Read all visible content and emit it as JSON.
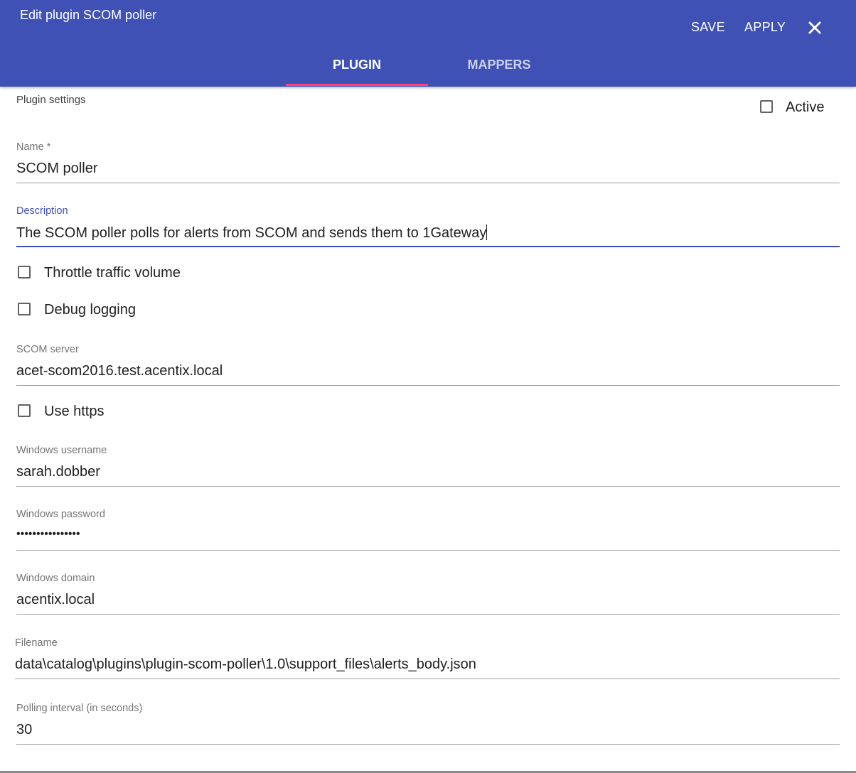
{
  "dialog": {
    "title": "Edit plugin SCOM poller",
    "save_label": "SAVE",
    "apply_label": "APPLY",
    "close_icon": "close-icon"
  },
  "tabs": [
    {
      "label": "PLUGIN",
      "active": true
    },
    {
      "label": "MAPPERS",
      "active": false
    }
  ],
  "colors": {
    "primary": "#3f51b5",
    "accent": "#ff4081"
  },
  "form": {
    "section_title": "Plugin settings",
    "active": {
      "label": "Active",
      "checked": false
    },
    "name": {
      "label": "Name *",
      "value": "SCOM poller"
    },
    "description": {
      "label": "Description",
      "value": "The SCOM poller polls for alerts from SCOM and sends them to 1Gateway",
      "focused": true
    },
    "throttle": {
      "label": "Throttle traffic volume",
      "checked": false
    },
    "debug": {
      "label": "Debug logging",
      "checked": false
    },
    "scom_server": {
      "label": "SCOM server",
      "value": "acet-scom2016.test.acentix.local"
    },
    "use_https": {
      "label": "Use https",
      "checked": false
    },
    "win_username": {
      "label": "Windows username",
      "value": "sarah.dobber"
    },
    "win_password": {
      "label": "Windows password",
      "value": "••••••••••••••••"
    },
    "win_domain": {
      "label": "Windows domain",
      "value": "acentix.local"
    },
    "filename": {
      "label": "Filename",
      "value": "data\\catalog\\plugins\\plugin-scom-poller\\1.0\\support_files\\alerts_body.json"
    },
    "polling_interval": {
      "label": "Polling interval (in seconds)",
      "value": "30"
    }
  }
}
